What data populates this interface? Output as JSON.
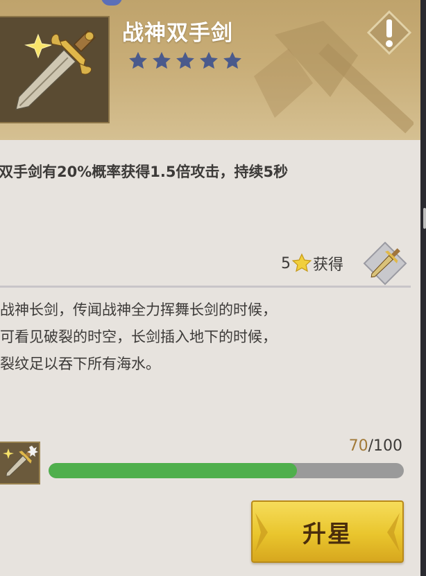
{
  "item": {
    "title": "战神双手剑",
    "star_rating": 5,
    "icon": "greatsword-icon"
  },
  "skill": {
    "text": "双手剑有20%概率获得1.5倍攻击，持续5秒"
  },
  "obtain": {
    "stars_required": "5",
    "label": "获得",
    "icon": "greatsword-icon"
  },
  "description": {
    "lines": [
      "战神长剑，传闻战神全力挥舞长剑的时候，",
      "可看见破裂的时空，长剑插入地下的时候，",
      "裂纹足以吞下所有海水。"
    ]
  },
  "progress": {
    "current": "70",
    "separator": "/",
    "max": "100",
    "fraction": 0.7
  },
  "upgrade_button": {
    "label": "升星"
  },
  "colors": {
    "header": "#c8ad77",
    "progress_fill": "#4faf4c",
    "progress_track": "#9a9a9a",
    "star_filled": "#4a5a8c",
    "button": "#e9c52d"
  }
}
